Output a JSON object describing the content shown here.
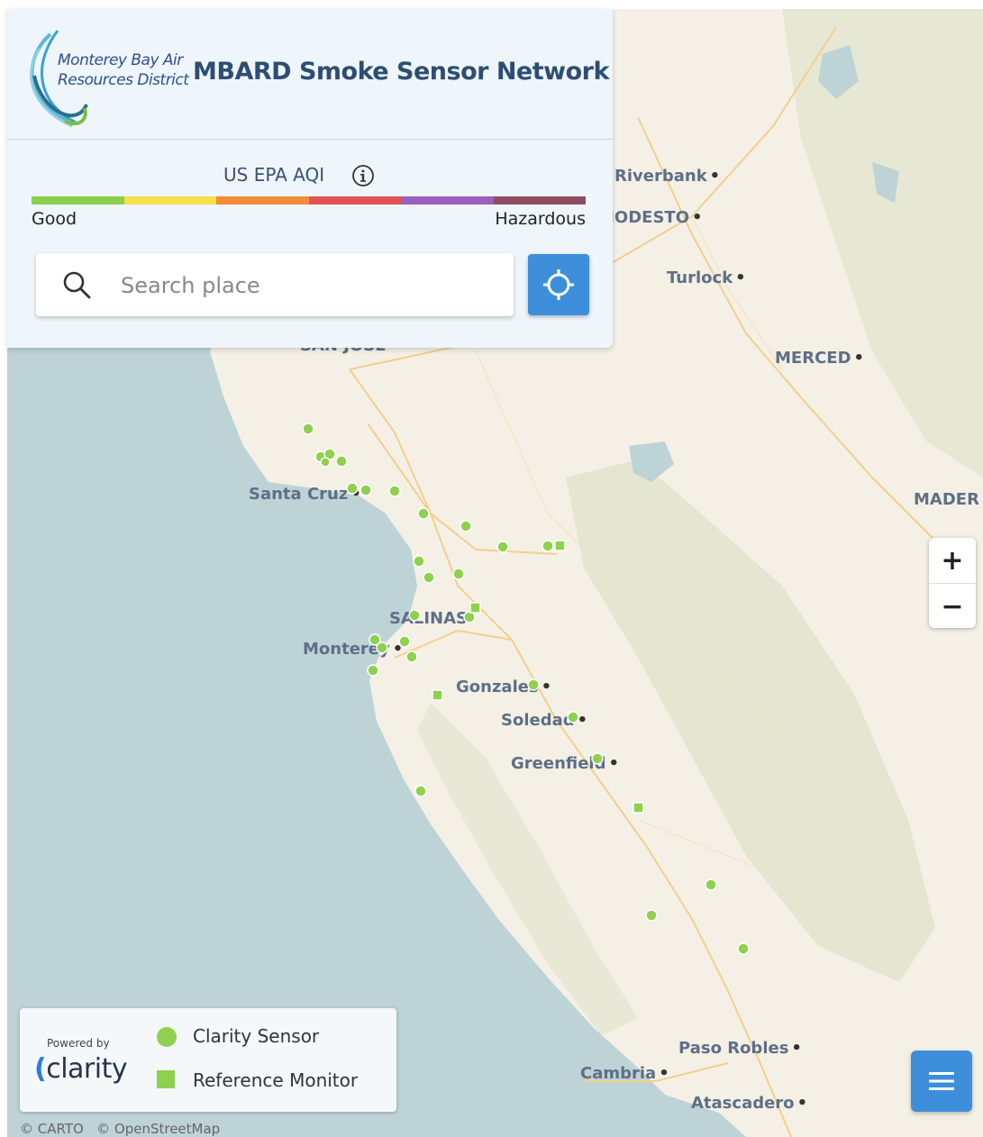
{
  "header": {
    "logo_line1": "Monterey Bay Air",
    "logo_line2": "Resources District",
    "title": "MBARD Smoke Sensor Network"
  },
  "aqi": {
    "title": "US EPA AQI",
    "low_label": "Good",
    "high_label": "Hazardous",
    "scale_colors": [
      "#8ccf4d",
      "#f5e14a",
      "#f08c3a",
      "#e05353",
      "#9a5fbf",
      "#8f4d62"
    ]
  },
  "search": {
    "placeholder": "Search place",
    "value": ""
  },
  "map": {
    "cities": [
      {
        "name": "Riverbank"
      },
      {
        "name": "MODESTO"
      },
      {
        "name": "Turlock"
      },
      {
        "name": "MERCED"
      },
      {
        "name": "MADER"
      },
      {
        "name": "SAN JOSE"
      },
      {
        "name": "Santa Cruz"
      },
      {
        "name": "SALINAS"
      },
      {
        "name": "Monterey"
      },
      {
        "name": "Gonzales"
      },
      {
        "name": "Soledad"
      },
      {
        "name": "Greenfield"
      },
      {
        "name": "Paso Robles"
      },
      {
        "name": "Cambria"
      },
      {
        "name": "Atascadero"
      }
    ],
    "sensor_color": "#8fd14f"
  },
  "zoom": {
    "in_label": "+",
    "out_label": "−"
  },
  "legend": {
    "powered_by": "Powered by",
    "brand": "clarity",
    "sensor_label": "Clarity Sensor",
    "monitor_label": "Reference Monitor"
  },
  "attribution": {
    "carto": "© CARTO",
    "osm": "© OpenStreetMap"
  }
}
